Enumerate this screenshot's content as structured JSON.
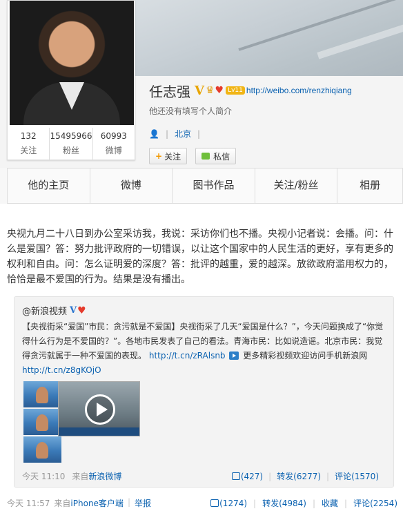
{
  "profile": {
    "name": "任志强",
    "level": "Lv11",
    "url": "http://weibo.com/renzhiqiang",
    "bio": "他还没有填写个人简介",
    "location": "北京",
    "follow_label": "关注",
    "message_label": "私信",
    "stats": [
      {
        "num": "132",
        "label": "关注"
      },
      {
        "num": "15495966",
        "label": "粉丝"
      },
      {
        "num": "60993",
        "label": "微博"
      }
    ]
  },
  "tabs": [
    "他的主页",
    "微博",
    "图书作品",
    "关注/粉丝",
    "相册"
  ],
  "post": {
    "text": "央视九月二十八日到办公室采访我，我说：采访你们也不播。央视小记者说：会播。问：什么是爱国？答：努力批评政府的一切错误，以让这个国家中的人民生活的更好，享有更多的权利和自由。问：怎么证明爱的深度？答：批评的越重，爱的越深。放欲政府滥用权力的，恰恰是最不爱国的行为。结果是没有播出。",
    "time": "今天 11:57",
    "source_prefix": "来自",
    "source": "iPhone客户端",
    "report": "举报",
    "likes": "(1274)",
    "repost": "转发(4984)",
    "favorite": "收藏",
    "comment": "评论(2254)"
  },
  "repost": {
    "author": "@新浪视频",
    "text": "【央视街采“爱国”市民：贪污就是不爱国】央视街采了几天“爱国是什么？”，今天问题换成了“你觉得什么行为是不爱国的？”。各地市民发表了自己的看法。青海市民：比如说造谣。北京市民：我觉得贪污就属于一种不爱国的表现。",
    "link1": "http://t.cn/zRAlsnb",
    "more": "更多精彩视频欢迎访问手机新浪网",
    "link2": "http://t.cn/z8gKOjO",
    "time": "今天 11:10",
    "source_prefix": "来自",
    "source": "新浪微博",
    "likes": "(427)",
    "repost": "转发(6277)",
    "comment": "评论(1570)"
  }
}
